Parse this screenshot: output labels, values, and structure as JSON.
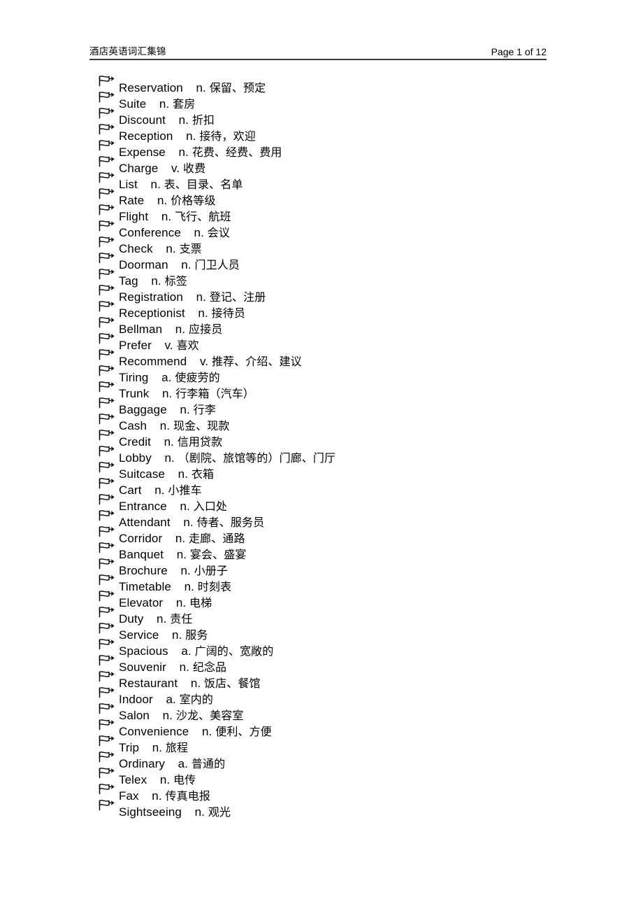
{
  "header": {
    "title": "酒店英语词汇集锦",
    "page_label": "Page 1 of 12"
  },
  "bullet": {
    "icon": "flag-bullet-icon"
  },
  "vocab": {
    "items": [
      {
        "word": "Reservation",
        "pos": "n.",
        "cn": " 保留、预定"
      },
      {
        "word": "Suite",
        "pos": "n.",
        "cn": " 套房"
      },
      {
        "word": "Discount",
        "pos": "n.",
        "cn": " 折扣"
      },
      {
        "word": "Reception",
        "pos": "n.",
        "cn": " 接待，欢迎"
      },
      {
        "word": "Expense",
        "pos": "n.",
        "cn": " 花费、经费、费用"
      },
      {
        "word": "Charge",
        "pos": "v.",
        "cn": " 收费"
      },
      {
        "word": "List",
        "pos": "n.",
        "cn": " 表、目录、名单"
      },
      {
        "word": "Rate",
        "pos": "n.",
        "cn": " 价格等级"
      },
      {
        "word": "Flight",
        "pos": "n.",
        "cn": "飞行、航班"
      },
      {
        "word": "Conference",
        "pos": "n.",
        "cn": " 会议"
      },
      {
        "word": "Check",
        "pos": "n.",
        "cn": " 支票"
      },
      {
        "word": "Doorman",
        "pos": "n.",
        "cn": " 门卫人员"
      },
      {
        "word": "Tag",
        "pos": "n.",
        "cn": " 标签"
      },
      {
        "word": "Registration",
        "pos": "n.",
        "cn": " 登记、注册"
      },
      {
        "word": "Receptionist",
        "pos": "n.",
        "cn": " 接待员"
      },
      {
        "word": "Bellman",
        "pos": "n.",
        "cn": " 应接员"
      },
      {
        "word": "Prefer",
        "pos": "v.",
        "cn": " 喜欢"
      },
      {
        "word": "Recommend",
        "pos": "v.",
        "cn": " 推荐、介绍、建议"
      },
      {
        "word": "Tiring",
        "pos": "a.",
        "cn": " 使疲劳的"
      },
      {
        "word": "Trunk",
        "pos": "n.",
        "cn": "行李箱（汽车）"
      },
      {
        "word": "Baggage",
        "pos": "n.",
        "cn": "行李"
      },
      {
        "word": "Cash",
        "pos": "n.",
        "cn": "现金、现款"
      },
      {
        "word": "Credit",
        "pos": "n.",
        "cn": "信用贷款"
      },
      {
        "word": "Lobby",
        "pos": "n.",
        "cn": "（剧院、旅馆等的）门廊、门厅"
      },
      {
        "word": "Suitcase",
        "pos": "n.",
        "cn": "衣箱"
      },
      {
        "word": "Cart",
        "pos": "n.",
        "cn": "小推车"
      },
      {
        "word": "Entrance",
        "pos": "n.",
        "cn": "入口处"
      },
      {
        "word": "Attendant",
        "pos": "n.",
        "cn": "侍者、服务员"
      },
      {
        "word": "Corridor",
        "pos": "n.",
        "cn": "走廊、通路"
      },
      {
        "word": "Banquet",
        "pos": "n.",
        "cn": "宴会、盛宴"
      },
      {
        "word": "Brochure",
        "pos": "n.",
        "cn": "小册子"
      },
      {
        "word": "Timetable",
        "pos": "n.",
        "cn": "时刻表"
      },
      {
        "word": "Elevator",
        "pos": "n.",
        "cn": "电梯"
      },
      {
        "word": "Duty",
        "pos": "n.",
        "cn": "责任"
      },
      {
        "word": "Service",
        "pos": "n.",
        "cn": "服务"
      },
      {
        "word": "Spacious",
        "pos": "a.",
        "cn": "广阔的、宽敞的"
      },
      {
        "word": "Souvenir",
        "pos": "n.",
        "cn": "纪念品"
      },
      {
        "word": "Restaurant",
        "pos": "n.",
        "cn": "饭店、餐馆"
      },
      {
        "word": "Indoor",
        "pos": "a.",
        "cn": "室内的"
      },
      {
        "word": "Salon",
        "pos": "n.",
        "cn": "沙龙、美容室"
      },
      {
        "word": "Convenience",
        "pos": "n.",
        "cn": "便利、方便"
      },
      {
        "word": "Trip",
        "pos": "n.",
        "cn": "旅程"
      },
      {
        "word": "Ordinary",
        "pos": "a.",
        "cn": "普通的"
      },
      {
        "word": "Telex",
        "pos": "n.",
        "cn": "电传"
      },
      {
        "word": "Fax",
        "pos": "n.",
        "cn": "传真电报"
      },
      {
        "word": "Sightseeing",
        "pos": "n.",
        "cn": "观光"
      }
    ]
  }
}
